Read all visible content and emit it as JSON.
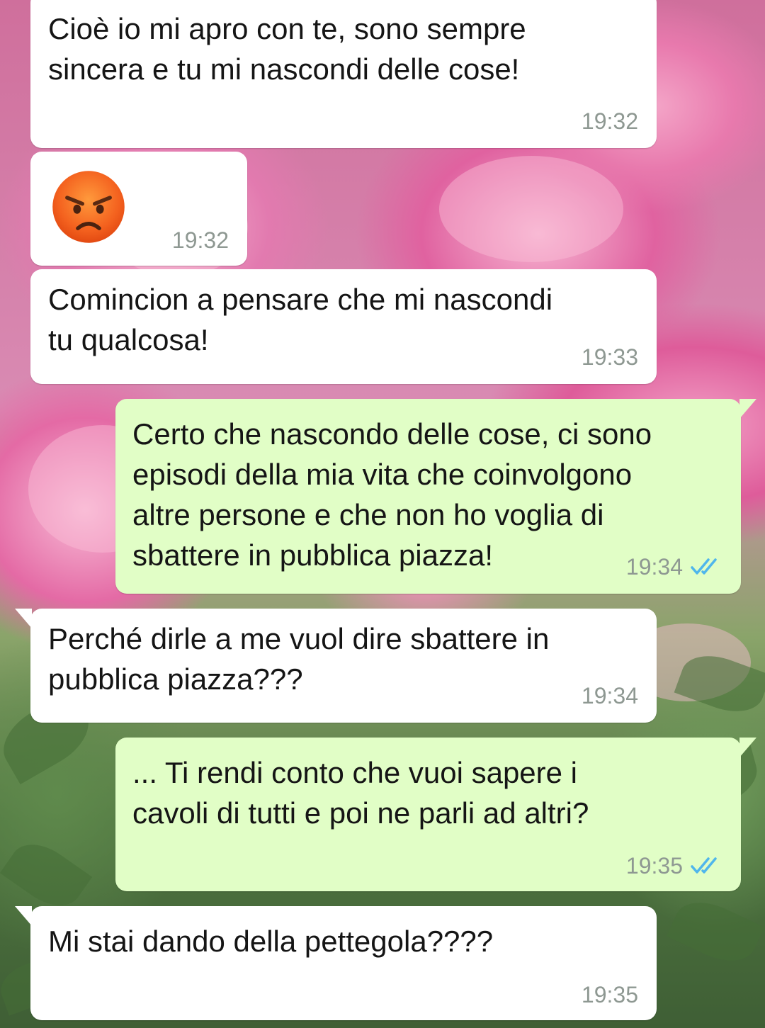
{
  "theme": {
    "incoming_bubble": "#ffffff",
    "outgoing_bubble": "#e1fec6",
    "timestamp_color": "#8e9892",
    "read_ticks_color": "#4fb6ec"
  },
  "messages": [
    {
      "direction": "incoming",
      "text": "Cioè io mi apro con te, sono sempre\nsincera e tu mi nascondi delle cose!",
      "time": "19:32"
    },
    {
      "direction": "incoming",
      "emoji": "angry-face-icon",
      "time": "19:32"
    },
    {
      "direction": "incoming",
      "text": "Comincion a pensare che mi nascondi\ntu qualcosa!",
      "time": "19:33"
    },
    {
      "direction": "outgoing",
      "text": "Certo che nascondo delle cose, ci sono\nepisodi della mia vita che coinvolgono\naltre persone e che non ho voglia di\nsbattere in pubblica piazza!",
      "time": "19:34",
      "status": "read-ticks-icon"
    },
    {
      "direction": "incoming",
      "text": "Perché dirle a me vuol dire sbattere in\npubblica piazza???",
      "time": "19:34"
    },
    {
      "direction": "outgoing",
      "text": "... Ti rendi conto che vuoi sapere i\ncavoli di tutti e poi ne parli ad altri?",
      "time": "19:35",
      "status": "read-ticks-icon"
    },
    {
      "direction": "incoming",
      "text": "Mi stai dando della pettegola????",
      "time": "19:35"
    }
  ]
}
